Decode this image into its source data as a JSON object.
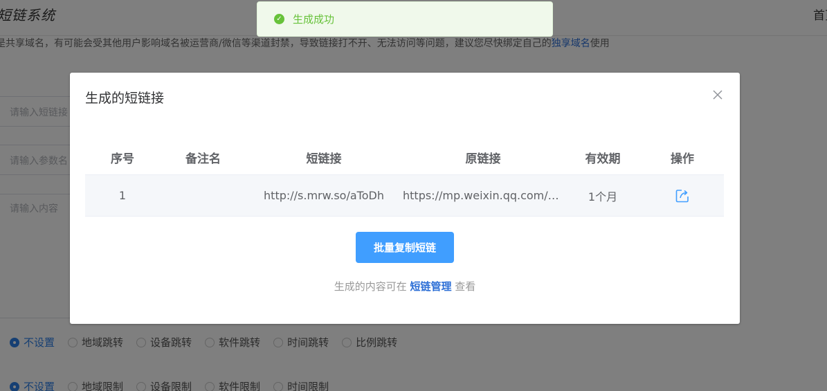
{
  "background": {
    "logo": "短链系统",
    "home_link": "首页",
    "notice": {
      "text": "是共享域名，有可能会受其他用户影响域名被运营商/微信等渠道封禁，导致链接打不开、无法访问等问题，建议您尽快绑定自己的",
      "highlight": "独享域名",
      "suffix": "使用"
    },
    "inputs": [
      {
        "placeholder": "请输入短链接"
      },
      {
        "placeholder": "请输入参数名"
      }
    ],
    "textarea_placeholder": "请输入内容",
    "jump_options": [
      "不设置",
      "地域跳转",
      "设备跳转",
      "软件跳转",
      "时间跳转",
      "比例跳转"
    ],
    "limit_options": [
      "不设置",
      "地域限制",
      "设备限制",
      "软件限制",
      "时间限制"
    ]
  },
  "toast": {
    "message": "生成成功",
    "color": "#67c23a"
  },
  "dialog": {
    "title": "生成的短链接",
    "columns": [
      "序号",
      "备注名",
      "短链接",
      "原链接",
      "有效期",
      "操作"
    ],
    "rows": [
      {
        "index": "1",
        "note": "",
        "short_link": "http://s.mrw.so/aToDh",
        "original_link": "https://mp.weixin.qq.com/s/MLS…",
        "validity": "1个月",
        "action_icon": "external-link-icon"
      }
    ],
    "copy_button": "批量复制短链",
    "hint_prefix": "生成的内容可在",
    "hint_link": "短链管理",
    "hint_suffix": "查看",
    "accent": "#409eff"
  }
}
